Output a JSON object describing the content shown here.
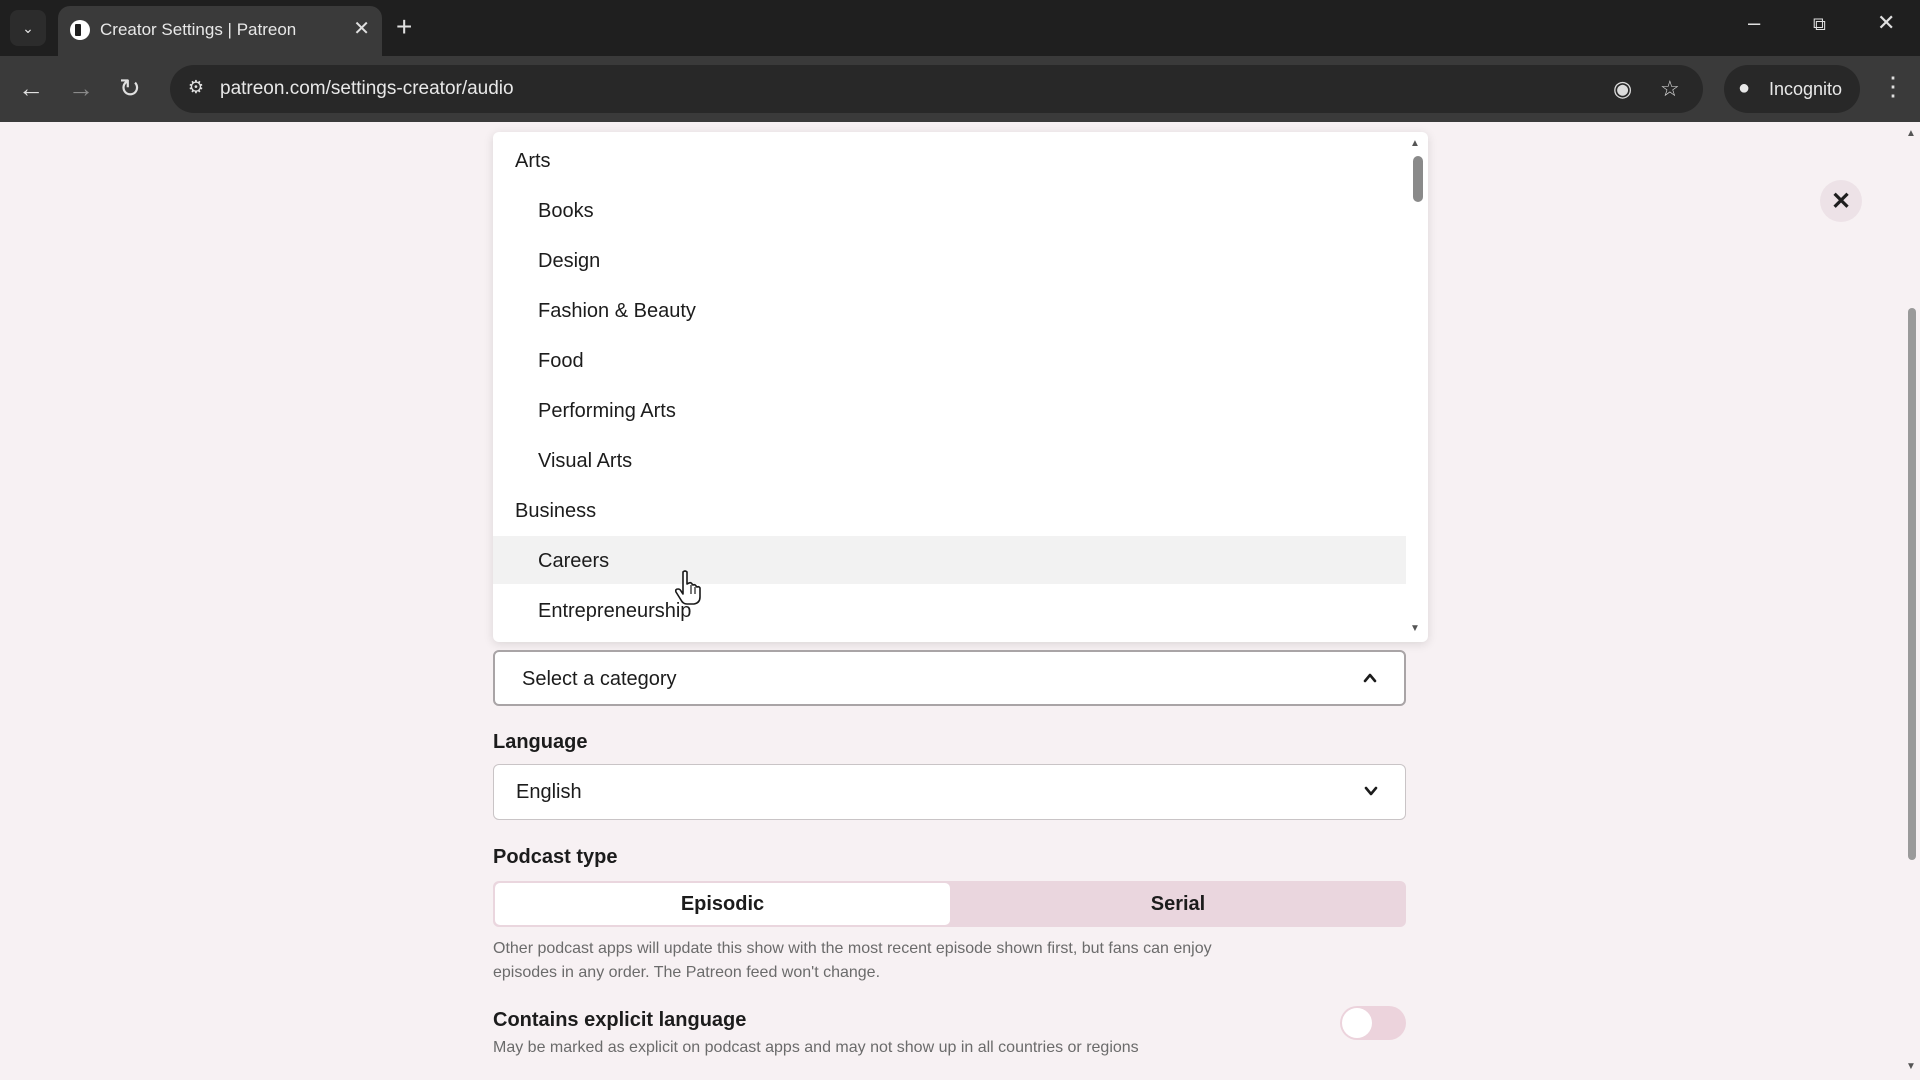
{
  "browser": {
    "tab_title": "Creator Settings | Patreon",
    "url": "patreon.com/settings-creator/audio",
    "incognito_label": "Incognito"
  },
  "category_dropdown": {
    "items": [
      {
        "label": "Arts",
        "level": "group"
      },
      {
        "label": "Books",
        "level": "child"
      },
      {
        "label": "Design",
        "level": "child"
      },
      {
        "label": "Fashion & Beauty",
        "level": "child"
      },
      {
        "label": "Food",
        "level": "child"
      },
      {
        "label": "Performing Arts",
        "level": "child"
      },
      {
        "label": "Visual Arts",
        "level": "child"
      },
      {
        "label": "Business",
        "level": "group"
      },
      {
        "label": "Careers",
        "level": "child",
        "hovered": true
      },
      {
        "label": "Entrepreneurship",
        "level": "child"
      }
    ],
    "placeholder": "Select a category"
  },
  "language": {
    "label": "Language",
    "value": "English"
  },
  "podcast_type": {
    "label": "Podcast type",
    "options": [
      "Episodic",
      "Serial"
    ],
    "selected": "Episodic",
    "help": "Other podcast apps will update this show with the most recent episode shown first, but fans can enjoy episodes in any order. The Patreon feed won't change."
  },
  "explicit": {
    "label": "Contains explicit language",
    "help": "May be marked as explicit on podcast apps and may not show up in all countries or regions",
    "enabled": false
  },
  "colors": {
    "page_bg": "#f7f1f3",
    "accent_pink": "#ead6de"
  }
}
